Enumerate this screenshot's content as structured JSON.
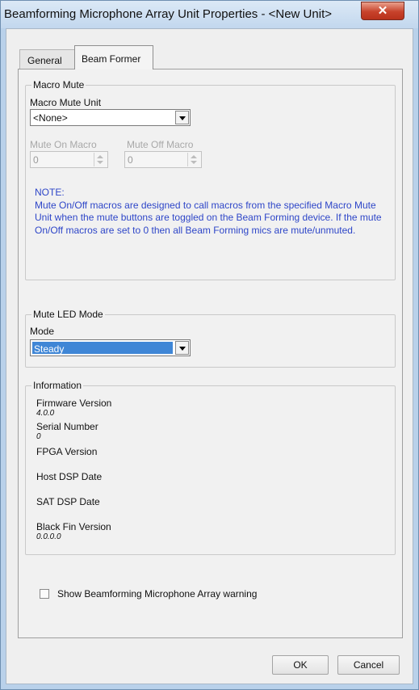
{
  "window": {
    "title": "Beamforming Microphone Array  Unit Properties - <New Unit>",
    "close_glyph": "✕"
  },
  "tabs": [
    {
      "label": "General"
    },
    {
      "label": "Beam Former"
    }
  ],
  "macro_mute": {
    "group_title": "Macro Mute",
    "unit_label": "Macro Mute Unit",
    "unit_value": "<None>",
    "mute_on_label": "Mute On Macro",
    "mute_on_value": "0",
    "mute_off_label": "Mute Off Macro",
    "mute_off_value": "0",
    "note_title": "NOTE:",
    "note_text": "Mute On/Off macros are designed to call macros from the specified Macro Mute Unit when the mute buttons are toggled on the Beam Forming device. If the mute On/Off macros are set to 0 then all Beam Forming mics are mute/unmuted."
  },
  "mute_led": {
    "group_title": "Mute LED Mode",
    "mode_label": "Mode",
    "mode_value": "Steady"
  },
  "information": {
    "group_title": "Information",
    "items": [
      {
        "label": "Firmware Version",
        "value": "4.0.0"
      },
      {
        "label": "Serial Number",
        "value": "0"
      },
      {
        "label": "FPGA Version",
        "value": ""
      },
      {
        "label": "Host DSP Date",
        "value": ""
      },
      {
        "label": "SAT DSP Date",
        "value": ""
      },
      {
        "label": "Black Fin Version",
        "value": "0.0.0.0"
      }
    ]
  },
  "warning_checkbox": {
    "label": "Show Beamforming Microphone Array warning",
    "checked": false
  },
  "buttons": {
    "ok": "OK",
    "cancel": "Cancel"
  },
  "colors": {
    "note_text": "#2e46c8",
    "selected_highlight": "#3f86d6",
    "close_button": "#c7422b"
  }
}
